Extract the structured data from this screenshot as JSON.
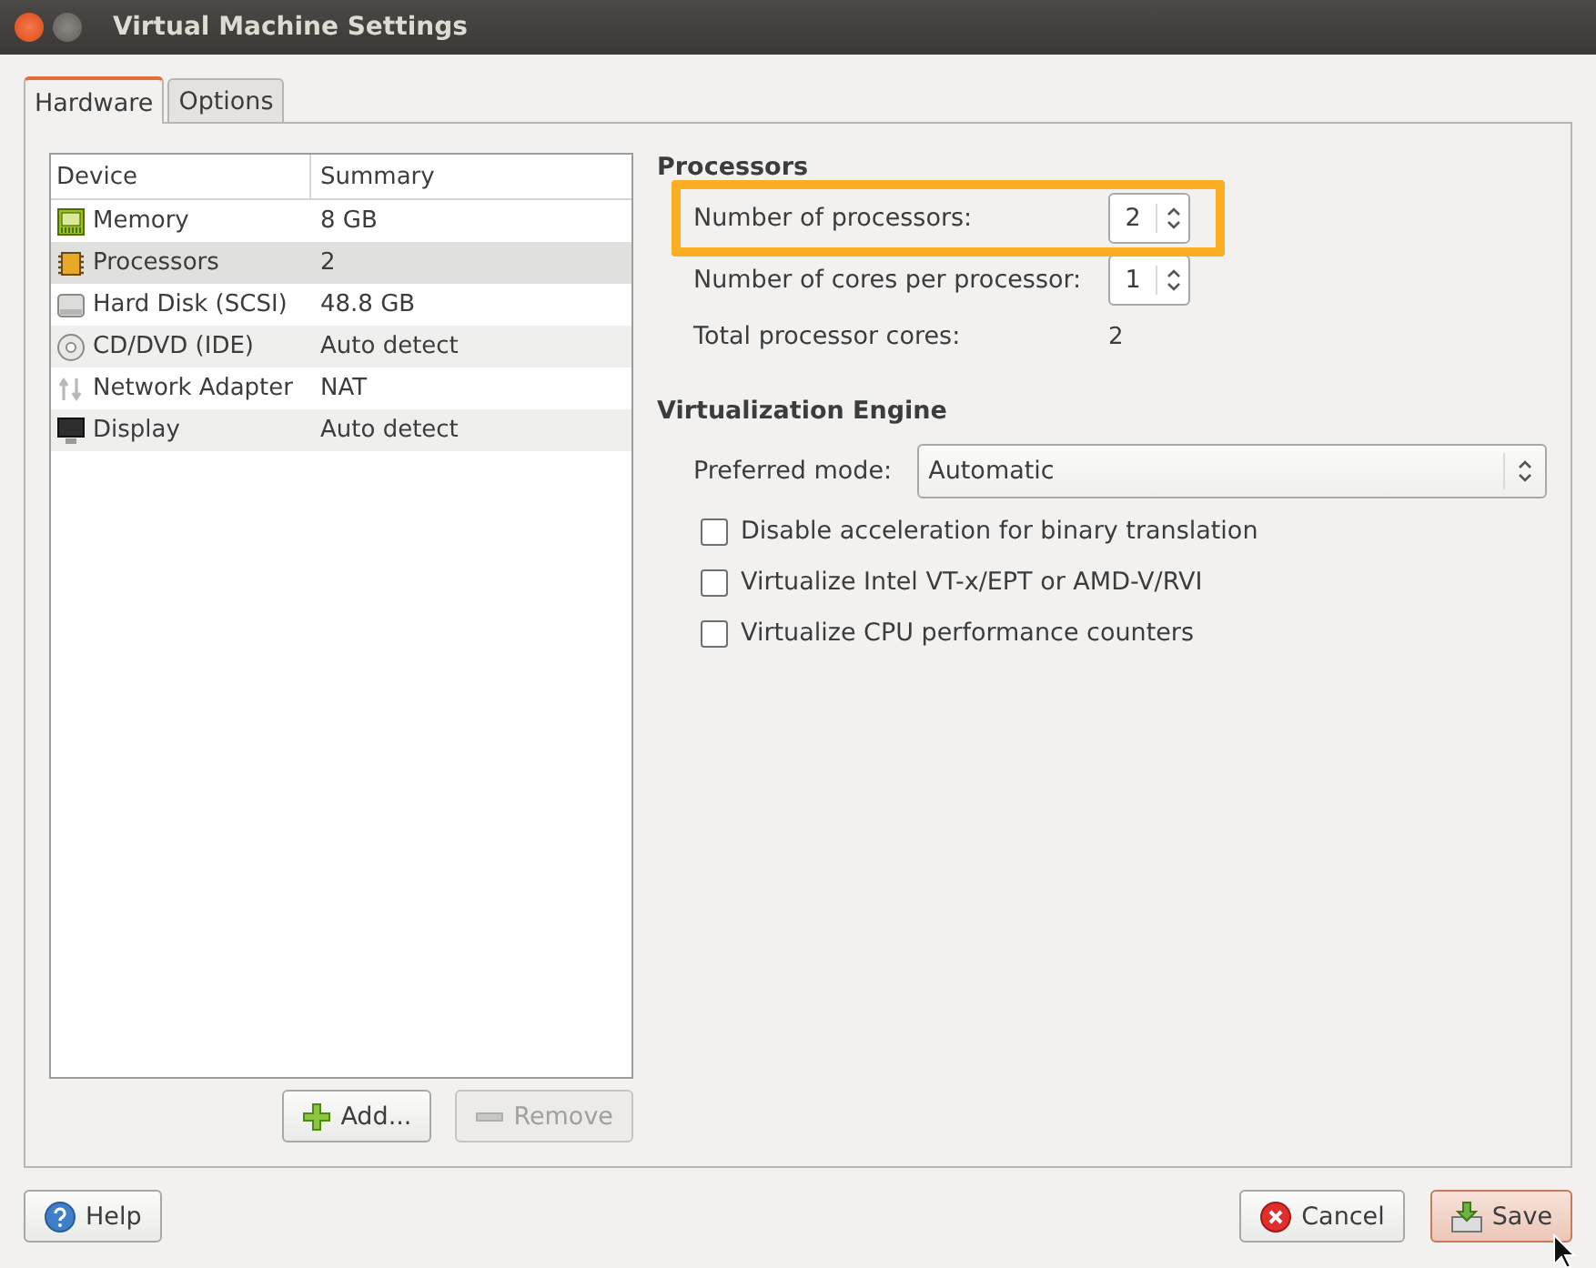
{
  "window": {
    "title": "Virtual Machine Settings"
  },
  "tabs": [
    {
      "label": "Hardware",
      "selected": true
    },
    {
      "label": "Options",
      "selected": false
    }
  ],
  "device_list": {
    "columns": [
      "Device",
      "Summary"
    ],
    "rows": [
      {
        "kind": "memory",
        "device": "Memory",
        "summary": "8 GB",
        "selected": false
      },
      {
        "kind": "processor",
        "device": "Processors",
        "summary": "2",
        "selected": true
      },
      {
        "kind": "disk",
        "device": "Hard Disk (SCSI)",
        "summary": "48.8 GB",
        "selected": false
      },
      {
        "kind": "cd",
        "device": "CD/DVD (IDE)",
        "summary": "Auto detect",
        "selected": false
      },
      {
        "kind": "network",
        "device": "Network Adapter",
        "summary": "NAT",
        "selected": false
      },
      {
        "kind": "display",
        "device": "Display",
        "summary": "Auto detect",
        "selected": false
      }
    ]
  },
  "device_buttons": [
    {
      "kind": "add",
      "label": "Add...",
      "disabled": false
    },
    {
      "kind": "remove",
      "label": "Remove",
      "disabled": true
    }
  ],
  "processors": {
    "title": "Processors",
    "fields": [
      {
        "kind": "spin",
        "label": "Number of processors:",
        "value": "2",
        "highlighted": true
      },
      {
        "kind": "spin",
        "label": "Number of cores per processor:",
        "value": "1",
        "highlighted": false
      },
      {
        "kind": "text",
        "label": "Total processor cores:",
        "value": "2",
        "highlighted": false
      }
    ]
  },
  "virtualization_engine": {
    "title": "Virtualization Engine",
    "preferred_mode": {
      "label": "Preferred mode:",
      "value": "Automatic"
    },
    "options": [
      {
        "label": "Disable acceleration for binary translation",
        "checked": false
      },
      {
        "label": "Virtualize Intel VT-x/EPT or AMD-V/RVI",
        "checked": false
      },
      {
        "label": "Virtualize CPU performance counters",
        "checked": false
      }
    ]
  },
  "footer_buttons": [
    {
      "kind": "help",
      "label": "Help",
      "default": false
    },
    {
      "kind": "cancel",
      "label": "Cancel",
      "default": false
    },
    {
      "kind": "save",
      "label": "Save",
      "default": true
    }
  ]
}
